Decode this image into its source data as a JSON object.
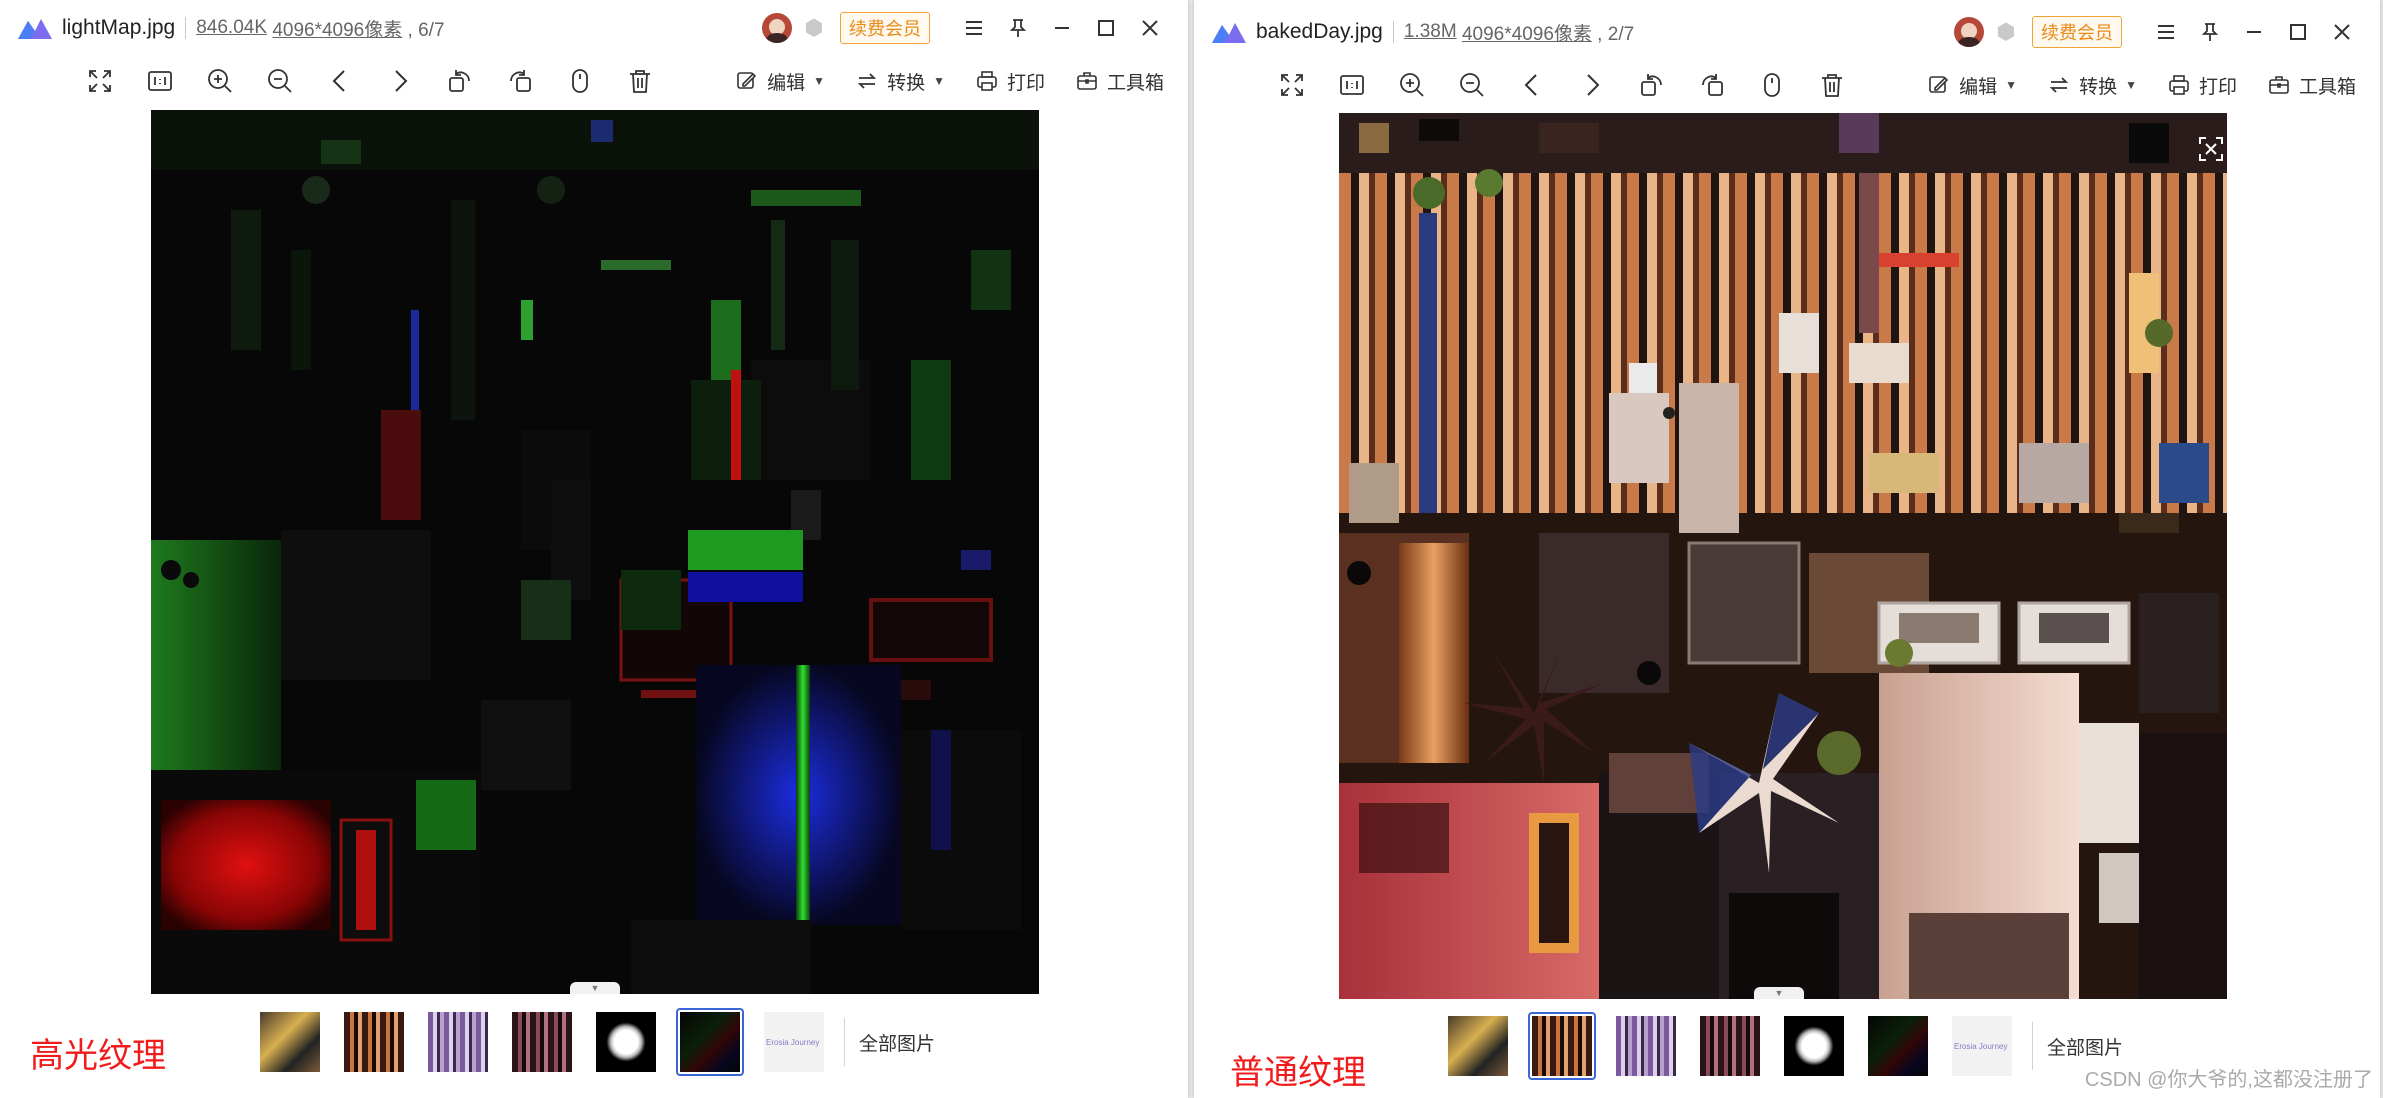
{
  "left_viewer": {
    "filename": "lightMap.jpg",
    "file_size": "846.04K",
    "dimensions": "4096*4096像素",
    "index": "6/7",
    "vip_label": "续费会员",
    "caption": "高光纹理",
    "image_description_icon": "dark-lightmap-atlas"
  },
  "right_viewer": {
    "filename": "bakedDay.jpg",
    "file_size": "1.38M",
    "dimensions": "4096*4096像素",
    "index": "2/7",
    "vip_label": "续费会员",
    "caption": "普通纹理"
  },
  "toolbar": {
    "edit_label": "编辑",
    "convert_label": "转换",
    "print_label": "打印",
    "toolbox_label": "工具箱",
    "icons": [
      "fullscreen-icon",
      "actual-size-icon",
      "zoom-in-icon",
      "zoom-out-icon",
      "previous-icon",
      "next-icon",
      "rotate-left-icon",
      "rotate-right-icon",
      "mouse-icon",
      "delete-icon"
    ]
  },
  "window_controls": [
    "menu-icon",
    "pin-icon",
    "minimize-icon",
    "maximize-icon",
    "close-icon"
  ],
  "thumbnails": {
    "all_images_label": "全部图片",
    "brand_thumb_text": "Erosia Journey"
  },
  "watermark": "CSDN @你大爷的,这都没注册了",
  "colors": {
    "accent_selected": "#3a66d6",
    "caption_red": "#f21b1b",
    "vip_orange": "#e88a16"
  }
}
